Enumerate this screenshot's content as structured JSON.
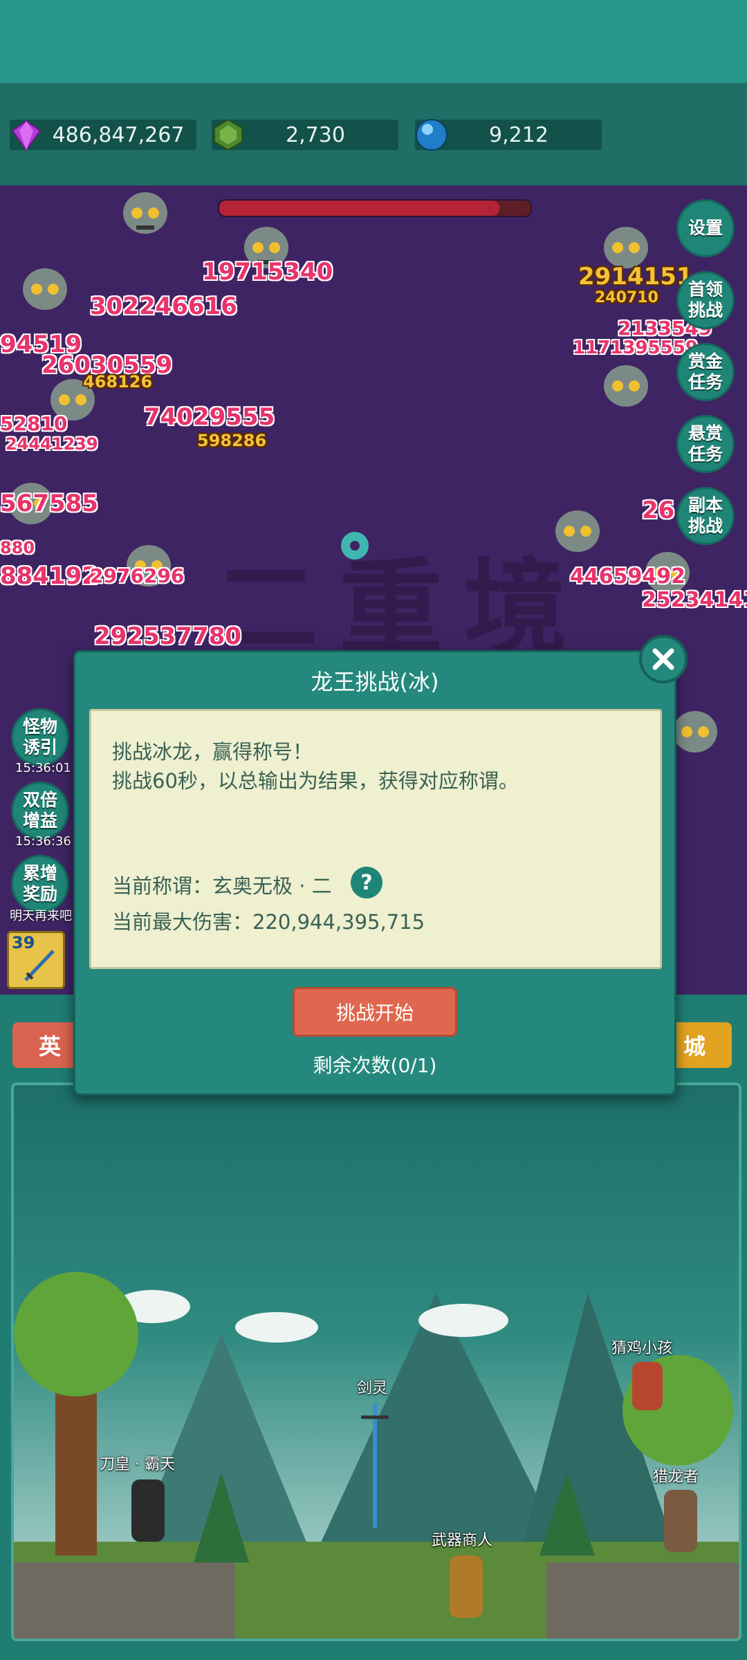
{
  "resources": {
    "diamond": "486,847,267",
    "green_gem": "2,730",
    "blue_orb": "9,212"
  },
  "boss_hp_fraction": 0.9,
  "battle": {
    "watermark": "二重境",
    "damage_numbers": [
      "19715340",
      "302246616",
      "94519",
      "26030559",
      "468126",
      "74029555",
      "598286",
      "52810",
      "24441239",
      "567585",
      "880",
      "884192",
      "2976296",
      "292537780",
      "2914151",
      "240710",
      "2133549",
      "1171395559",
      "26",
      "44659492",
      "25234141"
    ]
  },
  "right_menu": {
    "settings": "设置",
    "boss_challenge": "首领挑战",
    "bounty_task": "赏金任务",
    "reward_task": "悬赏任务",
    "dungeon_challenge": "副本挑战"
  },
  "left_menu": {
    "monster_lure": "怪物诱引",
    "monster_lure_timer": "15:36:01",
    "double_gain": "双倍增益",
    "double_gain_timer": "15:36:36",
    "cumulative_reward": "累增奖励",
    "cumulative_reward_note": "明天再来吧",
    "weapon_level": "39"
  },
  "tabs": {
    "left": "英",
    "right": "城"
  },
  "scene": {
    "npc_sword_spirit": "剑灵",
    "npc_blade_emperor": "刀皇 · 霸天",
    "npc_weapon_merchant": "武器商人",
    "npc_chicken_kid": "猜鸡小孩",
    "npc_dragon_hunter": "猎龙者"
  },
  "dialog": {
    "title": "龙王挑战(冰)",
    "line1": "挑战冰龙，赢得称号！",
    "line2": "挑战60秒，以总输出为结果，获得对应称谓。",
    "current_title_label": "当前称谓：玄奥无极 · 二",
    "max_damage_label": "当前最大伤害：220,944,395,715",
    "help": "?",
    "start_button": "挑战开始",
    "remaining": "剩余次数(0/1)"
  },
  "colors": {
    "teal": "#24897c",
    "battle_bg": "#3f2463",
    "start_button": "#e0674f",
    "panel_bg": "#eef0cf"
  }
}
